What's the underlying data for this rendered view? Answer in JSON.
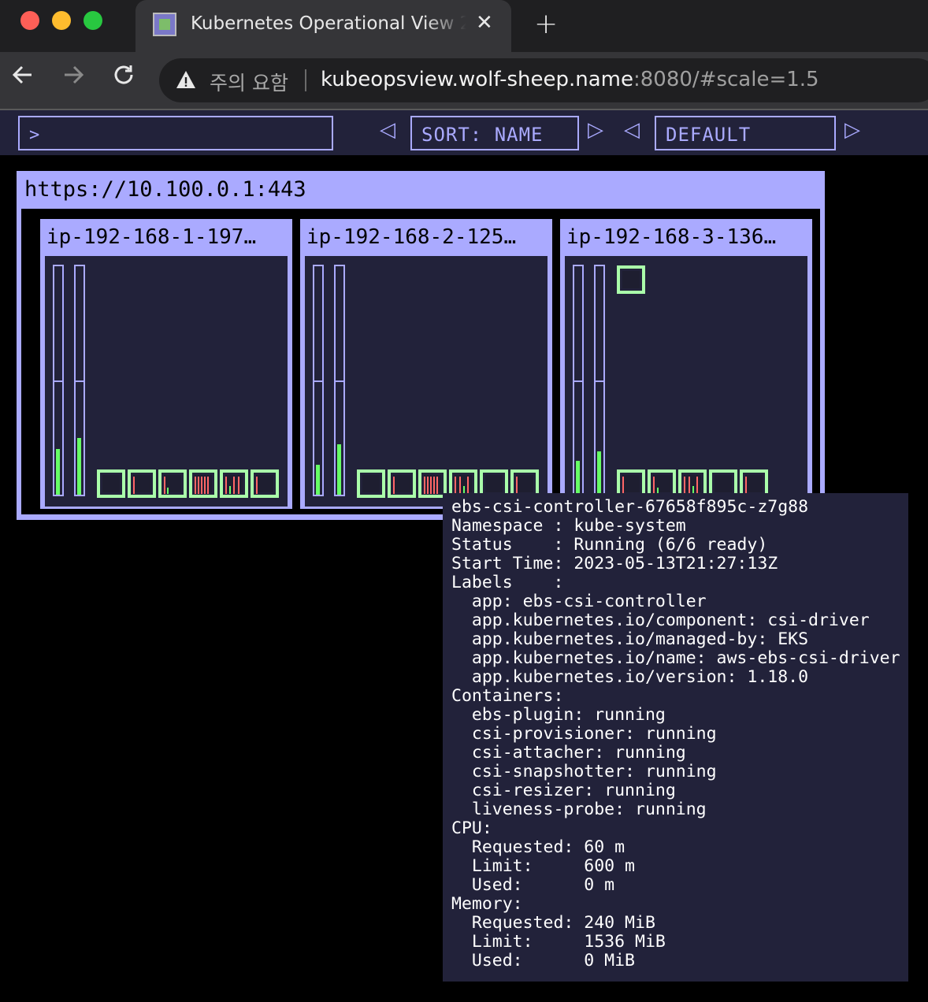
{
  "browser": {
    "tab_title": "Kubernetes Operational View 2",
    "tab_close": "✕",
    "new_tab": "+",
    "security_label": "주의 요함",
    "url_host": "kubeopsview.wolf-sheep.name",
    "url_rest": ":8080/#scale=1.5",
    "icons": [
      "back-arrow-icon",
      "forward-arrow-icon",
      "reload-icon",
      "warning-icon",
      "close-icon",
      "plus-icon"
    ]
  },
  "header": {
    "filter_value": ">",
    "sort_label": "SORT: NAME",
    "theme_label": "DEFAULT",
    "prev_arrow": "◁",
    "next_arrow": "▷"
  },
  "colors": {
    "accent": "#aaaaff",
    "pod_border": "#aaffaa",
    "panel_bg": "#22223a",
    "usage_green": "#66ff66",
    "usage_red": "#ff6666"
  },
  "cluster": {
    "title": "https://10.100.0.1:443",
    "nodes": [
      {
        "name": "ip-192-168-1-197…",
        "cpu_usage_fraction": 0.2,
        "memory_usage_fraction": 0.25,
        "pod_count": 6
      },
      {
        "name": "ip-192-168-2-125…",
        "cpu_usage_fraction": 0.13,
        "memory_usage_fraction": 0.22,
        "pod_count": 6
      },
      {
        "name": "ip-192-168-3-136…",
        "cpu_usage_fraction": 0.15,
        "memory_usage_fraction": 0.19,
        "pod_count": 6
      }
    ]
  },
  "tooltip": {
    "pod_name": "ebs-csi-controller-67658f895c-z7g88",
    "namespace": "Namespace : kube-system",
    "status": "Status    : Running (6/6 ready)",
    "start_time": "Start Time: 2023-05-13T21:27:13Z",
    "labels_heading": "Labels    :",
    "labels": [
      "  app: ebs-csi-controller",
      "  app.kubernetes.io/component: csi-driver",
      "  app.kubernetes.io/managed-by: EKS",
      "  app.kubernetes.io/name: aws-ebs-csi-driver",
      "  app.kubernetes.io/version: 1.18.0"
    ],
    "containers_heading": "Containers:",
    "containers": [
      "  ebs-plugin: running",
      "  csi-provisioner: running",
      "  csi-attacher: running",
      "  csi-snapshotter: running",
      "  csi-resizer: running",
      "  liveness-probe: running"
    ],
    "cpu_heading": "CPU:",
    "cpu": [
      "  Requested: 60 m",
      "  Limit:     600 m",
      "  Used:      0 m"
    ],
    "memory_heading": "Memory:",
    "memory": [
      "  Requested: 240 MiB",
      "  Limit:     1536 MiB",
      "  Used:      0 MiB"
    ]
  }
}
